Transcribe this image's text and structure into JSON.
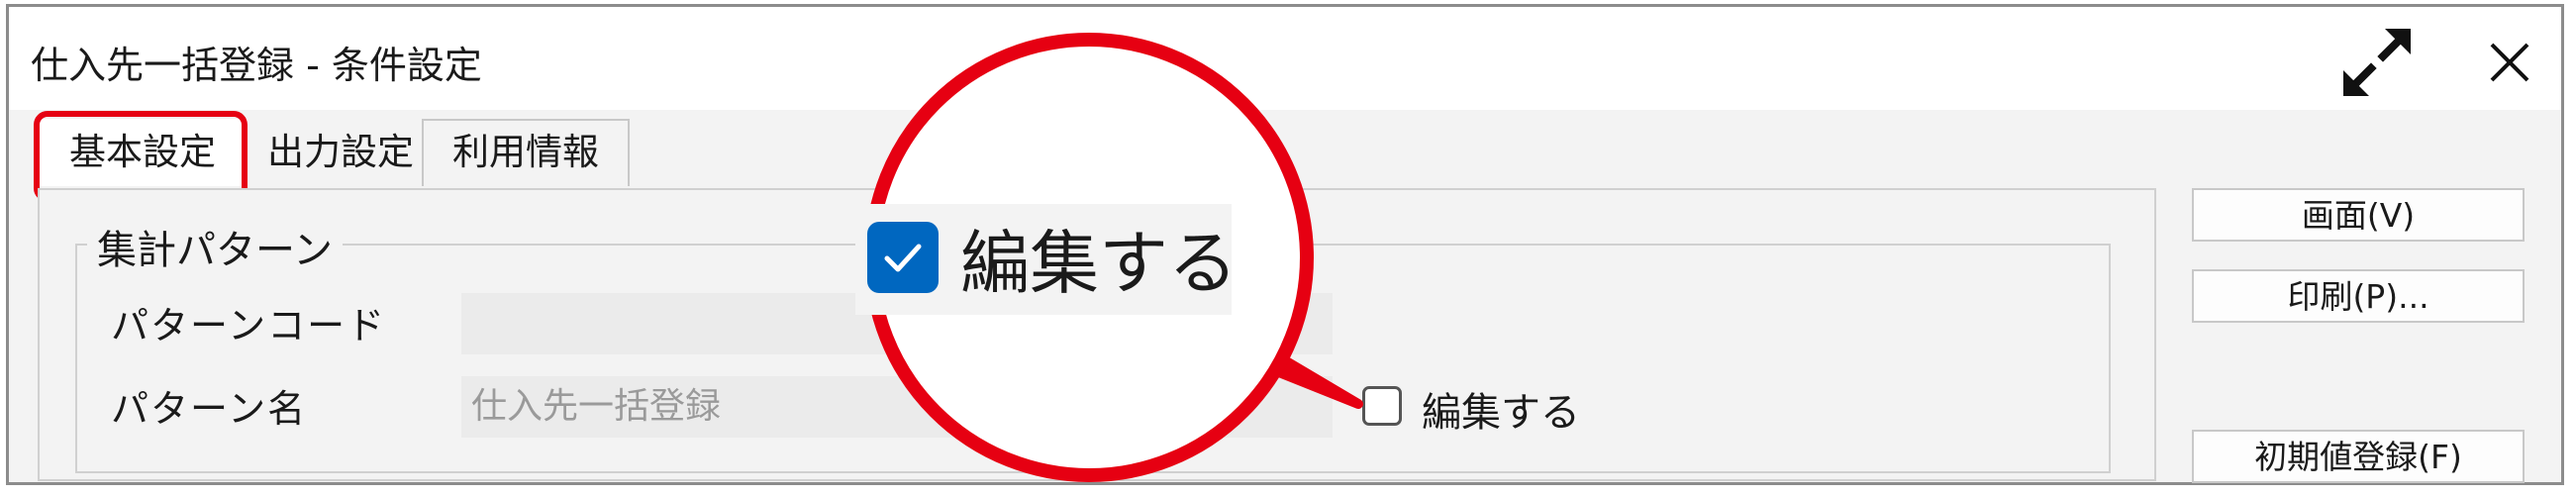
{
  "window": {
    "title": "仕入先一括登録 - 条件設定"
  },
  "tabs": [
    {
      "label": "基本設定"
    },
    {
      "label": "出力設定"
    },
    {
      "label": "利用情報"
    }
  ],
  "group": {
    "legend": "集計パターン",
    "pattern_code_label": "パターンコード",
    "pattern_code_value": "",
    "pattern_name_label": "パターン名",
    "pattern_name_value": "仕入先一括登録",
    "edit_checkbox_label": "編集する",
    "edit_checked": false
  },
  "side_buttons": {
    "screen": "画面(V)",
    "print": "印刷(P)...",
    "initial_register": "初期値登録(F)"
  },
  "callout": {
    "zoom_label": "編集する",
    "zoom_checked": true,
    "color": "#e60012"
  },
  "colors": {
    "highlight": "#e60012",
    "checkbox_blue": "#0067c0"
  }
}
